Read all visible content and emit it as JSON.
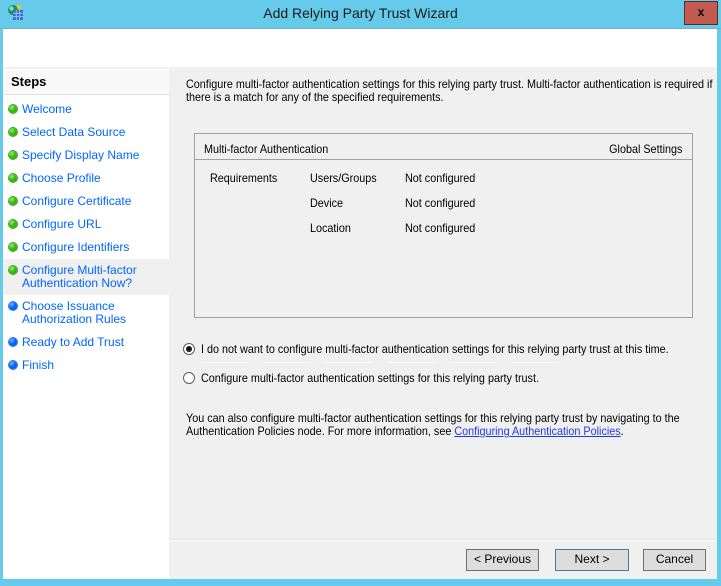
{
  "window": {
    "title": "Add Relying Party Trust Wizard",
    "close_label": "x"
  },
  "sidebar": {
    "heading": "Steps",
    "items": [
      {
        "label": "Welcome",
        "state": "done",
        "current": false
      },
      {
        "label": "Select Data Source",
        "state": "done",
        "current": false
      },
      {
        "label": "Specify Display Name",
        "state": "done",
        "current": false
      },
      {
        "label": "Choose Profile",
        "state": "done",
        "current": false
      },
      {
        "label": "Configure Certificate",
        "state": "done",
        "current": false
      },
      {
        "label": "Configure URL",
        "state": "done",
        "current": false
      },
      {
        "label": "Configure Identifiers",
        "state": "done",
        "current": false
      },
      {
        "label": "Configure Multi-factor Authentication Now?",
        "state": "done",
        "current": true
      },
      {
        "label": "Choose Issuance Authorization Rules",
        "state": "pending",
        "current": false
      },
      {
        "label": "Ready to Add Trust",
        "state": "pending",
        "current": false
      },
      {
        "label": "Finish",
        "state": "pending",
        "current": false
      }
    ]
  },
  "content": {
    "intro_line1": "Configure multi-factor authentication settings for this relying party trust. Multi-factor authentication is required if",
    "intro_line2": "there is a match for any of the specified requirements.",
    "table": {
      "header_left": "Multi-factor Authentication",
      "header_right": "Global Settings",
      "group_label": "Requirements",
      "rows": [
        {
          "name": "Users/Groups",
          "value": "Not configured"
        },
        {
          "name": "Device",
          "value": "Not configured"
        },
        {
          "name": "Location",
          "value": "Not configured"
        }
      ]
    },
    "radios": [
      {
        "label": "I do not want to configure multi-factor authentication settings for this relying party trust at this time.",
        "selected": true
      },
      {
        "label": "Configure multi-factor authentication settings for this relying party trust.",
        "selected": false
      }
    ],
    "footnote_line1": "You can also configure multi-factor authentication settings for this relying party trust by navigating to the",
    "footnote_line2_prefix": "Authentication Policies node. For more information, see ",
    "footnote_link": "Configuring Authentication Policies",
    "footnote_line2_suffix": "."
  },
  "footer": {
    "previous_label": "< Previous",
    "next_label": "Next >",
    "cancel_label": "Cancel"
  },
  "colors": {
    "titlebar": "#66cbea",
    "close_button": "#c35a50",
    "step_done_bullet": "#34bd0f",
    "step_pending_bullet": "#0066ff",
    "step_text": "#0066ff",
    "link": "#2038e8",
    "content_background": "#f0f0f0",
    "table_border": "#a0a0a0"
  }
}
